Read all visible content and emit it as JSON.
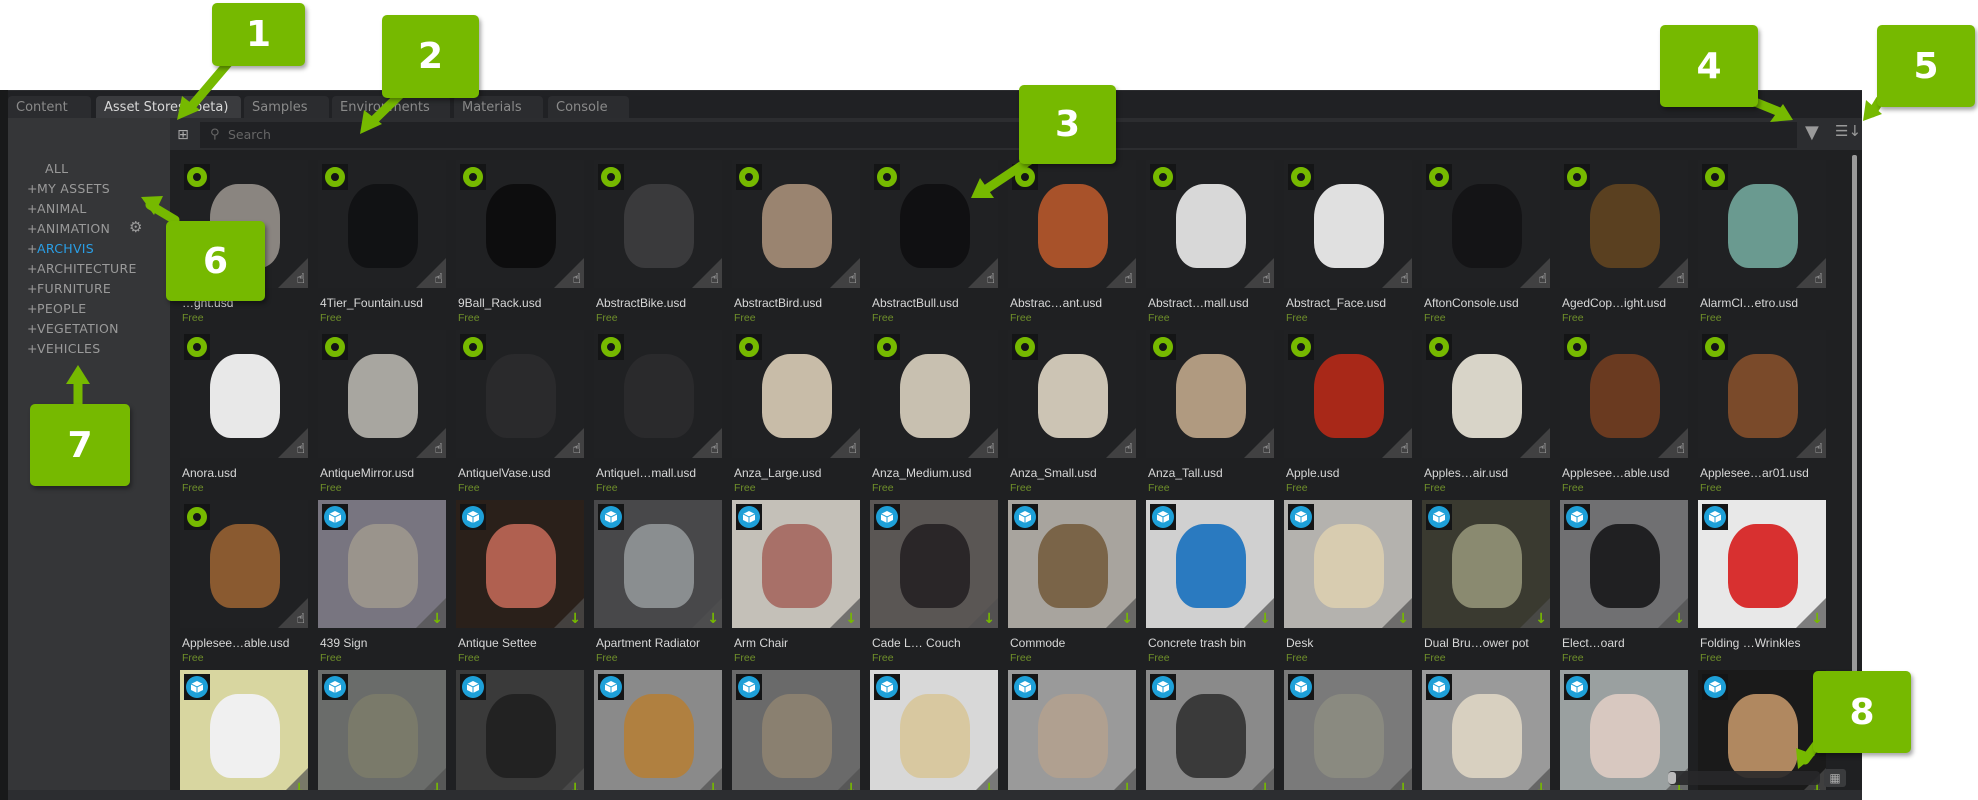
{
  "tabs": [
    {
      "label": "Content",
      "active": false
    },
    {
      "label": "Asset Stores (beta)",
      "active": true
    },
    {
      "label": "Samples",
      "active": false
    },
    {
      "label": "Environments",
      "active": false
    },
    {
      "label": "Materials",
      "active": false
    },
    {
      "label": "Console",
      "active": false
    }
  ],
  "search": {
    "placeholder": "Search",
    "icon": "search-icon"
  },
  "toolbar": {
    "tree_icon": "tree-view-icon",
    "filter_icon": "filter-icon",
    "sort_icon": "sort-icon"
  },
  "sidebar": {
    "items": [
      {
        "label": "ALL",
        "prefix": "",
        "active": false
      },
      {
        "label": "MY ASSETS",
        "prefix": "+",
        "active": false
      },
      {
        "label": "ANIMAL",
        "prefix": "+",
        "active": false
      },
      {
        "label": "ANIMATION",
        "prefix": "+",
        "active": false
      },
      {
        "label": "ARCHVIS",
        "prefix": "+",
        "active": true
      },
      {
        "label": "ARCHITECTURE",
        "prefix": "+",
        "active": false
      },
      {
        "label": "FURNITURE",
        "prefix": "+",
        "active": false
      },
      {
        "label": "PEOPLE",
        "prefix": "+",
        "active": false
      },
      {
        "label": "VEGETATION",
        "prefix": "+",
        "active": false
      },
      {
        "label": "VEHICLES",
        "prefix": "+",
        "active": false
      }
    ],
    "settings_icon": "gear-icon",
    "active_color": "#2a9fe6"
  },
  "colors": {
    "accent": "#76b900",
    "price": "#6f8f2a",
    "cube_badge": "#1ea0d8"
  },
  "assets": [
    {
      "name": "…ght.usd",
      "price": "Free",
      "store": "green",
      "action": "drag",
      "thumb": "#202123",
      "obj": "#8a8580"
    },
    {
      "name": "4Tier_Fountain.usd",
      "price": "Free",
      "store": "green",
      "action": "drag",
      "thumb": "#202123",
      "obj": "#111214"
    },
    {
      "name": "9Ball_Rack.usd",
      "price": "Free",
      "store": "green",
      "action": "drag",
      "thumb": "#202123",
      "obj": "#0d0d0e"
    },
    {
      "name": "AbstractBike.usd",
      "price": "Free",
      "store": "green",
      "action": "drag",
      "thumb": "#202123",
      "obj": "#3a3a3c"
    },
    {
      "name": "AbstractBird.usd",
      "price": "Free",
      "store": "green",
      "action": "drag",
      "thumb": "#202123",
      "obj": "#9a8470"
    },
    {
      "name": "AbstractBull.usd",
      "price": "Free",
      "store": "green",
      "action": "drag",
      "thumb": "#202123",
      "obj": "#101012"
    },
    {
      "name": "Abstrac…ant.usd",
      "price": "Free",
      "store": "green",
      "action": "drag",
      "thumb": "#202123",
      "obj": "#a8522a"
    },
    {
      "name": "Abstract…mall.usd",
      "price": "Free",
      "store": "green",
      "action": "drag",
      "thumb": "#202123",
      "obj": "#d8d8d8"
    },
    {
      "name": "Abstract_Face.usd",
      "price": "Free",
      "store": "green",
      "action": "drag",
      "thumb": "#202123",
      "obj": "#e0e0e0"
    },
    {
      "name": "AftonConsole.usd",
      "price": "Free",
      "store": "green",
      "action": "drag",
      "thumb": "#202123",
      "obj": "#141416"
    },
    {
      "name": "AgedCop…ight.usd",
      "price": "Free",
      "store": "green",
      "action": "drag",
      "thumb": "#202123",
      "obj": "#5a4020"
    },
    {
      "name": "AlarmCl…etro.usd",
      "price": "Free",
      "store": "green",
      "action": "drag",
      "thumb": "#202123",
      "obj": "#6a9a90"
    },
    {
      "name": "Anora.usd",
      "price": "Free",
      "store": "green",
      "action": "drag",
      "thumb": "#202123",
      "obj": "#e8e8e8"
    },
    {
      "name": "AntiqueMirror.usd",
      "price": "Free",
      "store": "green",
      "action": "drag",
      "thumb": "#202123",
      "obj": "#a8a6a0"
    },
    {
      "name": "AntiquelVase.usd",
      "price": "Free",
      "store": "green",
      "action": "drag",
      "thumb": "#202123",
      "obj": "#2a2a2c"
    },
    {
      "name": "Antiquel…mall.usd",
      "price": "Free",
      "store": "green",
      "action": "drag",
      "thumb": "#202123",
      "obj": "#2a2a2c"
    },
    {
      "name": "Anza_Large.usd",
      "price": "Free",
      "store": "green",
      "action": "drag",
      "thumb": "#202123",
      "obj": "#c8bca8"
    },
    {
      "name": "Anza_Medium.usd",
      "price": "Free",
      "store": "green",
      "action": "drag",
      "thumb": "#202123",
      "obj": "#c8c0b0"
    },
    {
      "name": "Anza_Small.usd",
      "price": "Free",
      "store": "green",
      "action": "drag",
      "thumb": "#202123",
      "obj": "#ccc4b4"
    },
    {
      "name": "Anza_Tall.usd",
      "price": "Free",
      "store": "green",
      "action": "drag",
      "thumb": "#202123",
      "obj": "#b09a80"
    },
    {
      "name": "Apple.usd",
      "price": "Free",
      "store": "green",
      "action": "drag",
      "thumb": "#202123",
      "obj": "#a82818"
    },
    {
      "name": "Apples…air.usd",
      "price": "Free",
      "store": "green",
      "action": "drag",
      "thumb": "#202123",
      "obj": "#d8d4c8"
    },
    {
      "name": "Applesee…able.usd",
      "price": "Free",
      "store": "green",
      "action": "drag",
      "thumb": "#202123",
      "obj": "#6a3a20"
    },
    {
      "name": "Applesee…ar01.usd",
      "price": "Free",
      "store": "green",
      "action": "drag",
      "thumb": "#202123",
      "obj": "#7a4a2a"
    },
    {
      "name": "Applesee…able.usd",
      "price": "Free",
      "store": "green",
      "action": "drag",
      "thumb": "#202123",
      "obj": "#8a5a30"
    },
    {
      "name": "439 Sign",
      "price": "Free",
      "store": "blue",
      "action": "download",
      "thumb": "#787580",
      "obj": "#9a948c"
    },
    {
      "name": "Antique Settee",
      "price": "Free",
      "store": "blue",
      "action": "download",
      "thumb": "#2a201a",
      "obj": "#b06050"
    },
    {
      "name": "Apartment Radiator",
      "price": "Free",
      "store": "blue",
      "action": "download",
      "thumb": "#48484a",
      "obj": "#8a8e90"
    },
    {
      "name": "Arm Chair",
      "price": "Free",
      "store": "blue",
      "action": "download",
      "thumb": "#c4c0b8",
      "obj": "#a87068"
    },
    {
      "name": "Cade L… Couch",
      "price": "Free",
      "store": "blue",
      "action": "download",
      "thumb": "#5a5654",
      "obj": "#2a2628"
    },
    {
      "name": "Commode",
      "price": "Free",
      "store": "blue",
      "action": "download",
      "thumb": "#a8a49e",
      "obj": "#7a6448"
    },
    {
      "name": "Concrete trash bin",
      "price": "Free",
      "store": "blue",
      "action": "download",
      "thumb": "#d0d0d0",
      "obj": "#2a7ac0"
    },
    {
      "name": "Desk",
      "price": "Free",
      "store": "blue",
      "action": "download",
      "thumb": "#b4b2ae",
      "obj": "#d8ccb0"
    },
    {
      "name": "Dual Bru…ower pot",
      "price": "Free",
      "store": "blue",
      "action": "download",
      "thumb": "#3a3a30",
      "obj": "#8a8a70"
    },
    {
      "name": "Elect…oard",
      "price": "Free",
      "store": "blue",
      "action": "download",
      "thumb": "#707072",
      "obj": "#202022"
    },
    {
      "name": "Folding …Wrinkles",
      "price": "Free",
      "store": "blue",
      "action": "download",
      "thumb": "#e8e8e8",
      "obj": "#d83030"
    },
    {
      "name": "",
      "price": "",
      "store": "blue",
      "action": "download",
      "thumb": "#d8d6a0",
      "obj": "#f0f0f0"
    },
    {
      "name": "",
      "price": "",
      "store": "blue",
      "action": "download",
      "thumb": "#6a6c6a",
      "obj": "#7a7a6a"
    },
    {
      "name": "",
      "price": "",
      "store": "blue",
      "action": "download",
      "thumb": "#3a3a3a",
      "obj": "#222"
    },
    {
      "name": "",
      "price": "",
      "store": "blue",
      "action": "download",
      "thumb": "#8a8a8a",
      "obj": "#b08040"
    },
    {
      "name": "",
      "price": "",
      "store": "blue",
      "action": "download",
      "thumb": "#6a6a6a",
      "obj": "#8a8070"
    },
    {
      "name": "",
      "price": "",
      "store": "blue",
      "action": "download",
      "thumb": "#d8d8d8",
      "obj": "#d8c8a0"
    },
    {
      "name": "",
      "price": "",
      "store": "blue",
      "action": "download",
      "thumb": "#9a9a9a",
      "obj": "#b0a090"
    },
    {
      "name": "",
      "price": "",
      "store": "blue",
      "action": "download",
      "thumb": "#8a8a8a",
      "obj": "#3a3a3a"
    },
    {
      "name": "",
      "price": "",
      "store": "blue",
      "action": "download",
      "thumb": "#7a7a7a",
      "obj": "#8a8a80"
    },
    {
      "name": "",
      "price": "",
      "store": "blue",
      "action": "download",
      "thumb": "#9a9a9a",
      "obj": "#d8d0c0"
    },
    {
      "name": "",
      "price": "",
      "store": "blue",
      "action": "download",
      "thumb": "#9aa0a0",
      "obj": "#d8c8c0"
    },
    {
      "name": "",
      "price": "",
      "store": "blue",
      "action": "download",
      "thumb": "#1a1a1a",
      "obj": "#b08860"
    }
  ],
  "thumbnail_size": {
    "icon": "grid-view-icon"
  },
  "callouts": [
    "1",
    "2",
    "3",
    "4",
    "5",
    "6",
    "7",
    "8"
  ]
}
